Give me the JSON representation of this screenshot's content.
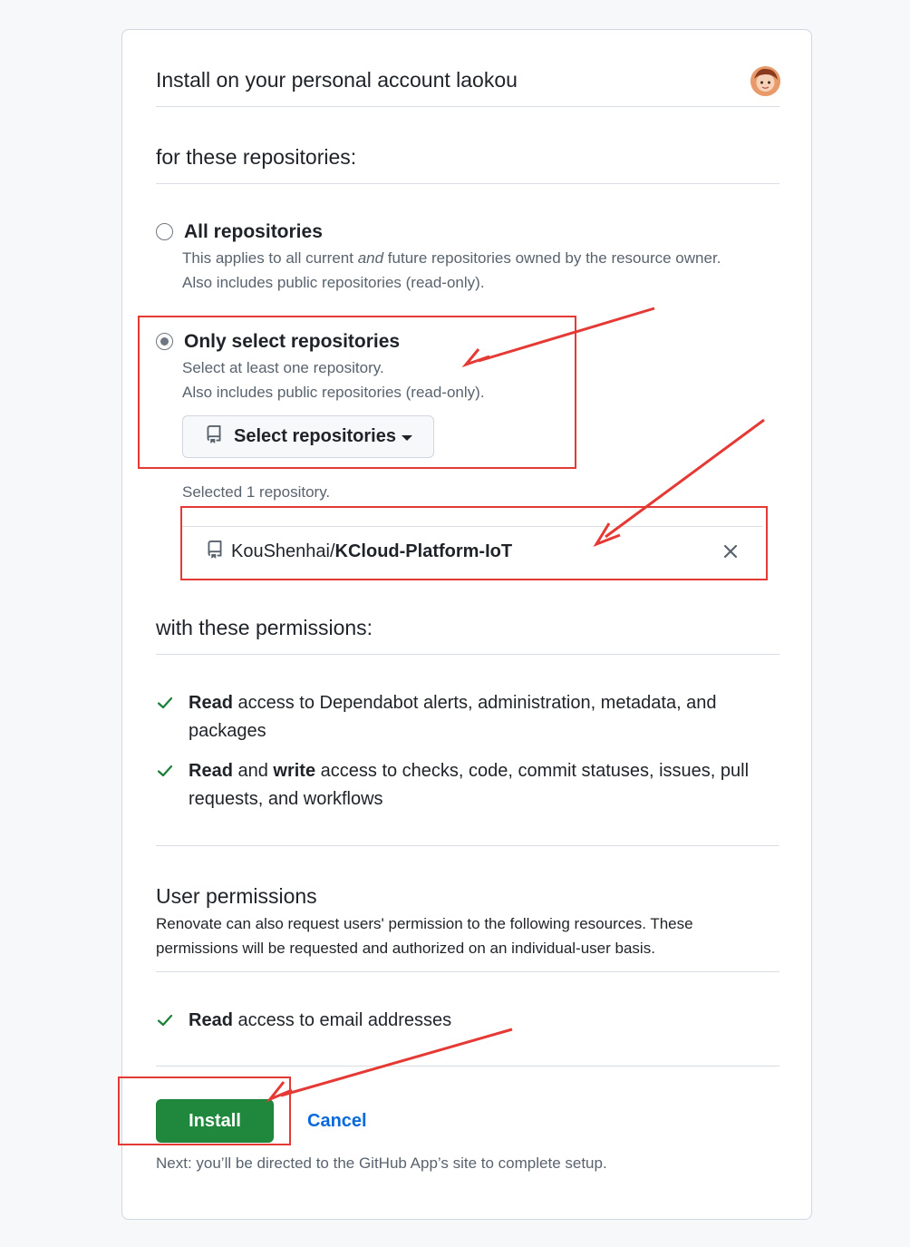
{
  "header": {
    "title": "Install on your personal account laokou"
  },
  "repositories": {
    "heading": "for these repositories:",
    "all": {
      "label": "All repositories",
      "desc_pre": "This applies to all current ",
      "desc_em": "and",
      "desc_post": " future repositories owned by the resource owner.",
      "desc2": "Also includes public repositories (read-only).",
      "checked": false
    },
    "select": {
      "label": "Only select repositories",
      "desc1": "Select at least one repository.",
      "desc2": "Also includes public repositories (read-only).",
      "checked": true,
      "button_label": "Select repositories"
    },
    "selected_count_text": "Selected 1 repository.",
    "selected": [
      {
        "owner": "KouShenhai/",
        "name": "KCloud-Platform-IoT"
      }
    ]
  },
  "permissions": {
    "heading": "with these permissions:",
    "items": [
      {
        "bold1": "Read",
        "mid": "",
        "bold2": "",
        "rest": " access to Dependabot alerts, administration, metadata, and packages"
      },
      {
        "bold1": "Read",
        "mid": " and ",
        "bold2": "write",
        "rest": " access to checks, code, commit statuses, issues, pull requests, and workflows"
      }
    ]
  },
  "user_permissions": {
    "heading": "User permissions",
    "desc": "Renovate can also request users' permission to the following resources. These permissions will be requested and authorized on an individual-user basis.",
    "items": [
      {
        "bold1": "Read",
        "rest": " access to email addresses"
      }
    ]
  },
  "actions": {
    "install_label": "Install",
    "cancel_label": "Cancel",
    "note": "Next: you’ll be directed to the GitHub App’s site to complete setup."
  },
  "colors": {
    "primary_button": "#1f883d",
    "link": "#0969da",
    "check": "#1a7f37",
    "annotation": "#e53935"
  }
}
